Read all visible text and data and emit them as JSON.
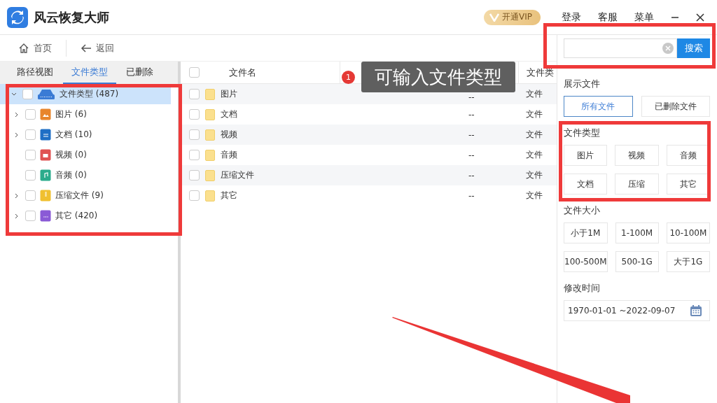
{
  "app": {
    "title": "风云恢复大师",
    "vip": "开通VIP",
    "menu": [
      "登录",
      "客服",
      "菜单"
    ]
  },
  "toolbar": {
    "home": "首页",
    "back": "返回"
  },
  "left_tabs": [
    {
      "label": "路径视图",
      "selected": false
    },
    {
      "label": "文件类型",
      "selected": true
    },
    {
      "label": "已删除",
      "selected": false
    }
  ],
  "tree": {
    "label": "文件类型 (487)",
    "checked": false,
    "expanded": true,
    "selected": true,
    "children": [
      {
        "label": "图片 (6)",
        "kind": "image",
        "color": "#e8852c",
        "checked": false,
        "expandable": true
      },
      {
        "label": "文档 (10)",
        "kind": "document",
        "color": "#1f6fc5",
        "checked": false,
        "expandable": true
      },
      {
        "label": "视频 (0)",
        "kind": "video",
        "color": "#e05252",
        "checked": false,
        "expandable": false
      },
      {
        "label": "音频 (0)",
        "kind": "audio",
        "color": "#2bab8c",
        "checked": false,
        "expandable": false
      },
      {
        "label": "压缩文件 (9)",
        "kind": "archive",
        "color": "#f0c030",
        "checked": false,
        "expandable": true
      },
      {
        "label": "其它 (420)",
        "kind": "other",
        "color": "#8a5ad6",
        "checked": false,
        "expandable": true
      }
    ]
  },
  "table": {
    "select_all_checked": false,
    "columns": [
      "文件名",
      "文件类"
    ],
    "rows": [
      {
        "name": "图片",
        "size": "--",
        "type": "文件",
        "checked": false
      },
      {
        "name": "文档",
        "size": "--",
        "type": "文件",
        "checked": false
      },
      {
        "name": "视频",
        "size": "--",
        "type": "文件",
        "checked": false
      },
      {
        "name": "音频",
        "size": "--",
        "type": "文件",
        "checked": false
      },
      {
        "name": "压缩文件",
        "size": "--",
        "type": "文件",
        "checked": false
      },
      {
        "name": "其它",
        "size": "--",
        "type": "文件",
        "checked": false
      }
    ]
  },
  "annotation": {
    "badge": "1",
    "text": "可输入文件类型"
  },
  "search": {
    "button": "搜索"
  },
  "filters": {
    "show_title": "展示文件",
    "show": [
      {
        "label": "所有文件",
        "selected": true
      },
      {
        "label": "已删除文件",
        "selected": false
      }
    ],
    "type_title": "文件类型",
    "types": [
      {
        "label": "图片",
        "selected": false
      },
      {
        "label": "视频",
        "selected": false
      },
      {
        "label": "音频",
        "selected": false
      },
      {
        "label": "文档",
        "selected": false
      },
      {
        "label": "压缩",
        "selected": false
      },
      {
        "label": "其它",
        "selected": false
      }
    ],
    "size_title": "文件大小",
    "sizes": [
      {
        "label": "小于1M",
        "selected": false
      },
      {
        "label": "1-100M",
        "selected": false
      },
      {
        "label": "10-100M",
        "selected": false
      },
      {
        "label": "100-500M",
        "selected": false
      },
      {
        "label": "500-1G",
        "selected": false
      },
      {
        "label": "大于1G",
        "selected": false
      }
    ],
    "time_title": "修改时间",
    "date_range": "1970-01-01 ~2022-09-07"
  }
}
